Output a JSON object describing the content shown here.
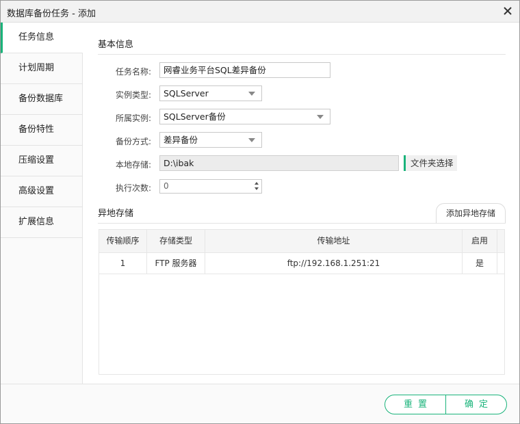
{
  "window": {
    "title": "数据库备份任务 - 添加"
  },
  "sidebar": {
    "items": [
      {
        "label": "任务信息",
        "active": true
      },
      {
        "label": "计划周期"
      },
      {
        "label": "备份数据库"
      },
      {
        "label": "备份特性"
      },
      {
        "label": "压缩设置"
      },
      {
        "label": "高级设置"
      },
      {
        "label": "扩展信息"
      }
    ]
  },
  "basic": {
    "title": "基本信息",
    "task_name_label": "任务名称:",
    "task_name_value": "网睿业务平台SQL差异备份",
    "instance_type_label": "实例类型:",
    "instance_type_value": "SQLServer",
    "instance_label": "所属实例:",
    "instance_value": "SQLServer备份",
    "backup_mode_label": "备份方式:",
    "backup_mode_value": "差异备份",
    "local_storage_label": "本地存储:",
    "local_storage_value": "D:\\ibak",
    "folder_button": "文件夹选择",
    "exec_count_label": "执行次数:",
    "exec_count_value": "0"
  },
  "remote": {
    "title": "异地存储",
    "add_button": "添加异地存储",
    "columns": [
      "传输顺序",
      "存储类型",
      "传输地址",
      "启用"
    ],
    "rows": [
      [
        "1",
        "FTP 服务器",
        "ftp://192.168.1.251:21",
        "是"
      ]
    ]
  },
  "footer": {
    "reset_label": "重置",
    "ok_label": "确定"
  },
  "colors": {
    "accent": "#19b37a"
  },
  "icons": {
    "close": "close-icon",
    "dropdown": "caret-down-icon",
    "spinner": "spinner-arrows-icon"
  }
}
